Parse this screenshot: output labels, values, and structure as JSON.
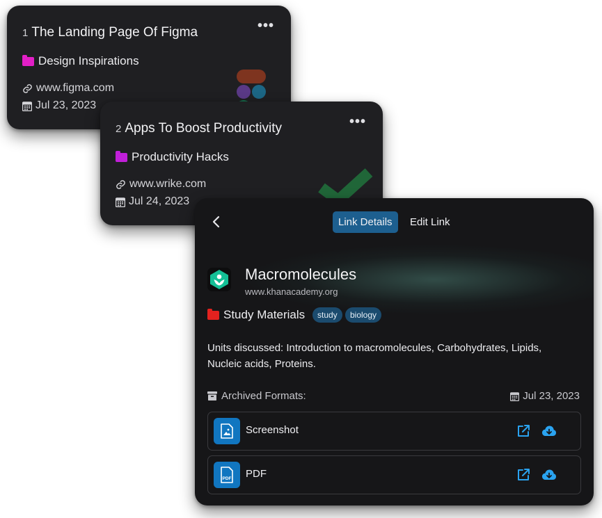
{
  "cards": [
    {
      "number": "1",
      "title": "The Landing Page Of Figma",
      "folder": "Design Inspirations",
      "folder_color": "#e21fc6",
      "url": "www.figma.com",
      "date": "Jul 23, 2023",
      "thumbnail_icon": "figma-logo-icon"
    },
    {
      "number": "2",
      "title": "Apps To Boost Productivity",
      "folder": "Productivity Hacks",
      "folder_color": "#c11fd9",
      "url": "www.wrike.com",
      "date": "Jul 24, 2023",
      "thumbnail_icon": "wrike-check-icon"
    }
  ],
  "more_label": "•••",
  "detail": {
    "back_label": "‹",
    "tabs": [
      "Link Details",
      "Edit Link"
    ],
    "title": "Macromolecules",
    "url": "www.khanacademy.org",
    "logo_icon": "khan-academy-logo-icon",
    "folder": "Study Materials",
    "folder_color": "#e3221f",
    "tags": [
      "study",
      "biology"
    ],
    "description": "Units discussed: Introduction to macromolecules, Carbohydrates, Lipids, Nucleic acids, Proteins.",
    "archived_label": "Archived Formats:",
    "date": "Jul 23, 2023",
    "formats": [
      {
        "label": "Screenshot",
        "icon": "image-file-icon"
      },
      {
        "label": "PDF",
        "icon": "pdf-file-icon",
        "badge": "PDF"
      }
    ]
  },
  "colors": {
    "accent": "#1d5f8f",
    "format_icon_bg": "#1176c0",
    "action": "#2aa3f0"
  }
}
